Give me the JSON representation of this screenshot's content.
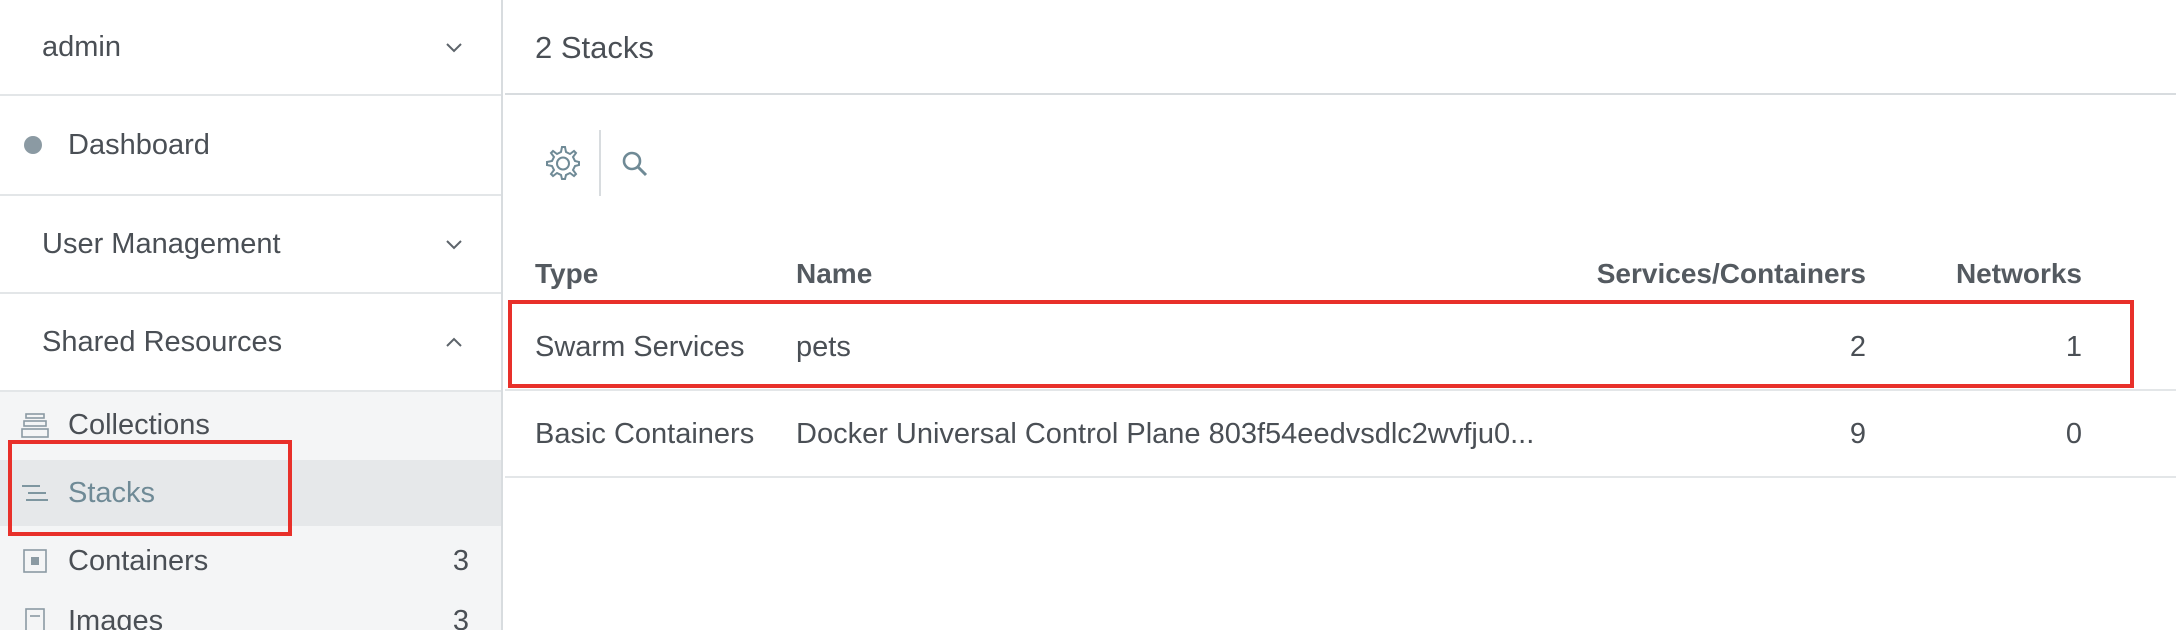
{
  "sidebar": {
    "user": "admin",
    "dashboard": "Dashboard",
    "user_management": "User Management",
    "shared_resources": "Shared Resources",
    "sub_items": [
      {
        "label": "Collections",
        "count": ""
      },
      {
        "label": "Stacks",
        "count": ""
      },
      {
        "label": "Containers",
        "count": "3"
      },
      {
        "label": "Images",
        "count": "3"
      }
    ]
  },
  "main": {
    "title": "2 Stacks",
    "table": {
      "headers": [
        "Type",
        "Name",
        "Services/Containers",
        "Networks"
      ],
      "rows": [
        {
          "type": "Swarm Services",
          "name": "pets",
          "services": "2",
          "networks": "1"
        },
        {
          "type": "Basic Containers",
          "name": "Docker Universal Control Plane 803f54eedvsdlc2wvfju0...",
          "services": "9",
          "networks": "0"
        }
      ]
    }
  },
  "colors": {
    "highlight": "#e8302a",
    "active_text": "#6f8a96",
    "icon": "#6f8a96"
  },
  "icons": [
    "chevron-down-icon",
    "status-dot-icon",
    "chevron-up-icon",
    "collections-icon",
    "stacks-icon",
    "containers-icon",
    "images-icon",
    "gear-icon",
    "search-icon"
  ]
}
